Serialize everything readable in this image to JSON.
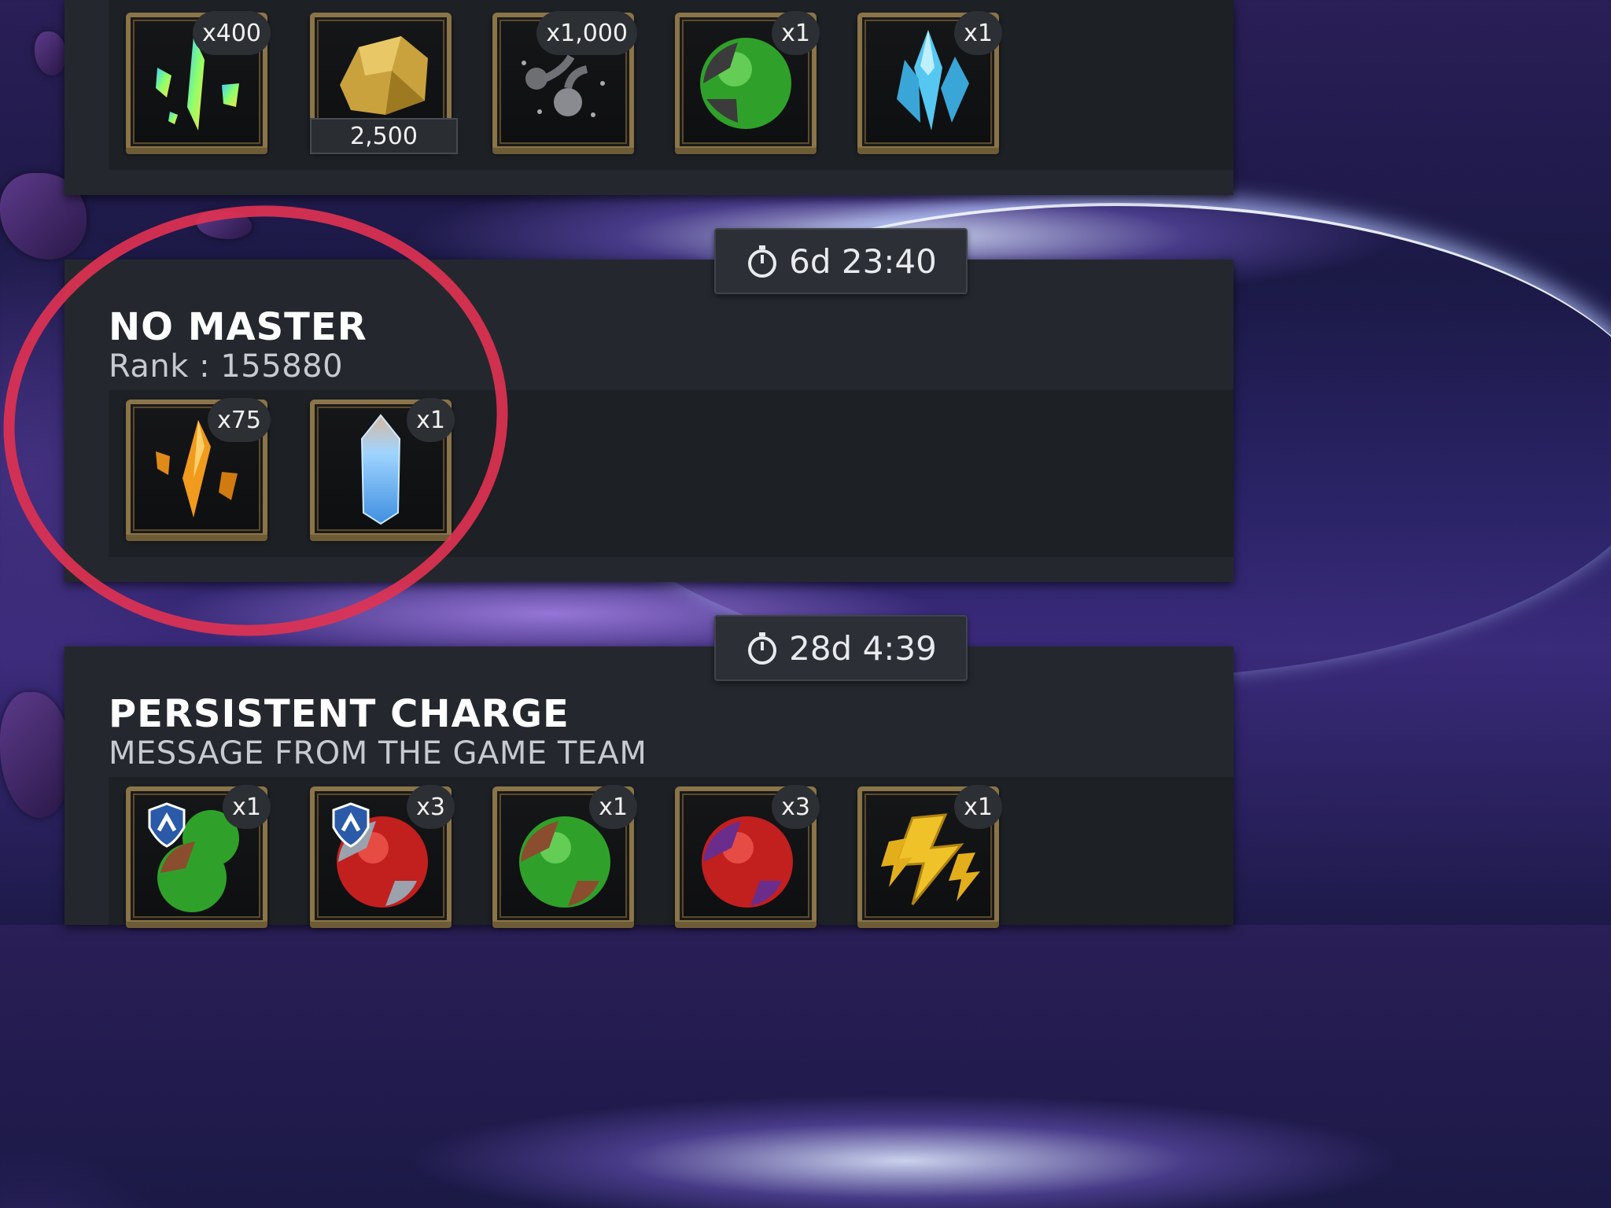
{
  "colors": {
    "panel": "#24282e",
    "strip": "#1d2025",
    "frame_gold": "#8a7448",
    "annotation_red": "#e23252"
  },
  "top_section": {
    "rewards": [
      {
        "icon": "rainbow-shards-icon",
        "qty": "x400"
      },
      {
        "icon": "gold-nugget-icon",
        "amount": "2,500"
      },
      {
        "icon": "alpha-catalyst-icon",
        "qty": "x1,000"
      },
      {
        "icon": "green-potion-orb-icon",
        "qty": "x1"
      },
      {
        "icon": "blue-crystal-cluster-icon",
        "qty": "x1"
      }
    ]
  },
  "no_master": {
    "timer": "6d 23:40",
    "title": "NO MASTER",
    "rank_text": "Rank : 155880",
    "rewards": [
      {
        "icon": "orange-shards-icon",
        "qty": "x75"
      },
      {
        "icon": "blue-crystal-icon",
        "qty": "x1"
      }
    ]
  },
  "persistent_charge": {
    "timer": "28d 4:39",
    "title": "PERSISTENT CHARGE",
    "subtitle": "MESSAGE FROM THE GAME TEAM",
    "rewards": [
      {
        "icon": "alliance-green-potion-icon",
        "qty": "x1"
      },
      {
        "icon": "alliance-red-revive-icon",
        "qty": "x3"
      },
      {
        "icon": "green-potion-icon",
        "qty": "x1"
      },
      {
        "icon": "purple-red-revive-icon",
        "qty": "x3"
      },
      {
        "icon": "gold-energy-bolt-icon",
        "qty": "x1"
      }
    ]
  }
}
